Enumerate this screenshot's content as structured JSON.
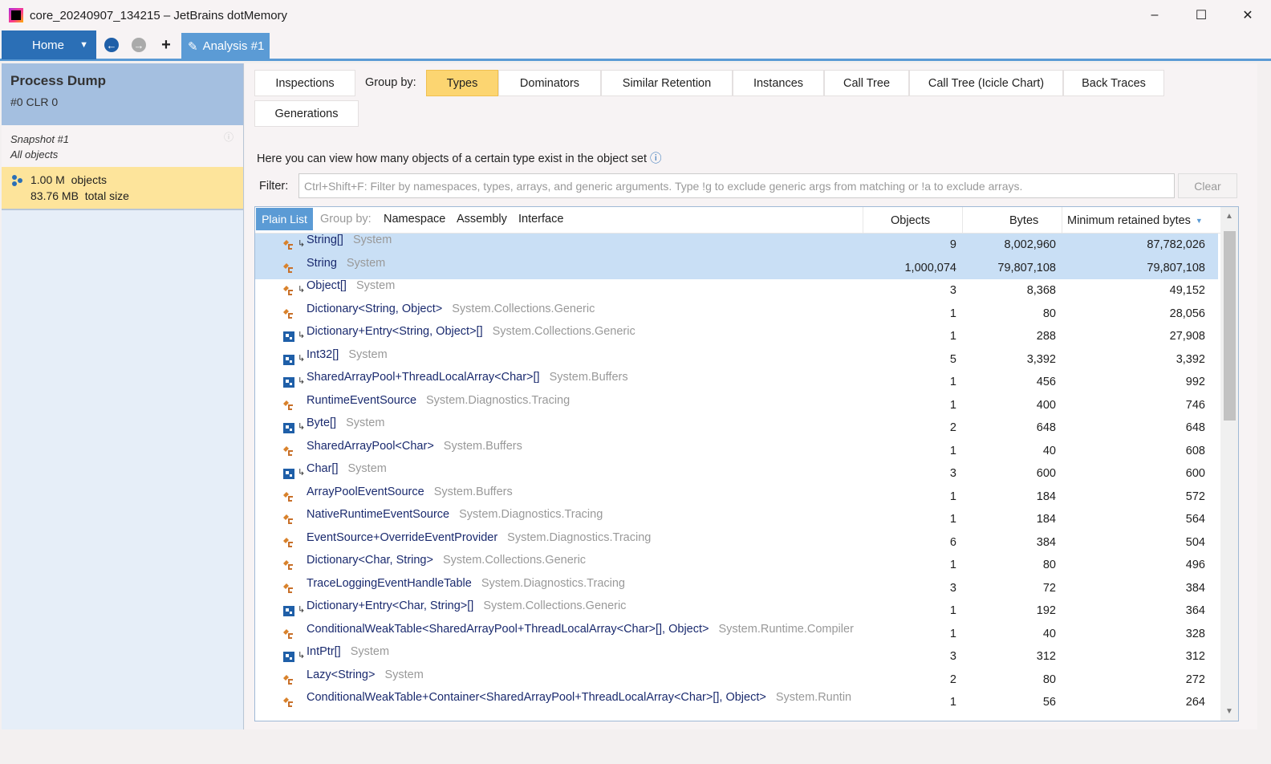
{
  "window": {
    "title": "core_20240907_134215 – JetBrains dotMemory",
    "min": "–",
    "max": "☐",
    "close": "✕"
  },
  "nav": {
    "home": "Home",
    "tab": "Analysis #1"
  },
  "left": {
    "title": "Process Dump",
    "subtitle": "#0 CLR 0",
    "snapshot": "Snapshot #1",
    "scope": "All objects",
    "count": "1.00 M",
    "count_label": "objects",
    "size": "83.76 MB",
    "size_label": "total size"
  },
  "views": {
    "inspections": "Inspections",
    "group_by": "Group by:",
    "types": "Types",
    "dominators": "Dominators",
    "similar": "Similar Retention",
    "instances": "Instances",
    "calltree": "Call Tree",
    "icicle": "Call Tree (Icicle Chart)",
    "backtraces": "Back Traces",
    "generations": "Generations"
  },
  "description": "Here you can view how many objects of a certain type exist in the object set",
  "filter": {
    "label": "Filter:",
    "placeholder": "Ctrl+Shift+F: Filter by namespaces, types, arrays, and generic arguments. Type !g to exclude generic args from matching or !a to exclude arrays.",
    "clear": "Clear"
  },
  "grid": {
    "plain_list": "Plain List",
    "group_by": "Group by:",
    "namespace": "Namespace",
    "assembly": "Assembly",
    "interface": "Interface",
    "col_objects": "Objects",
    "col_bytes": "Bytes",
    "col_retained": "Minimum retained bytes",
    "rows": [
      {
        "icon": "class",
        "array": true,
        "name": "String[]",
        "ns": "System",
        "objects": "9",
        "bytes": "8,002,960",
        "retained": "87,782,026",
        "selected": true
      },
      {
        "icon": "class",
        "array": false,
        "name": "String",
        "ns": "System",
        "objects": "1,000,074",
        "bytes": "79,807,108",
        "retained": "79,807,108",
        "selected": true
      },
      {
        "icon": "class",
        "array": true,
        "name": "Object[]",
        "ns": "System",
        "objects": "3",
        "bytes": "8,368",
        "retained": "49,152"
      },
      {
        "icon": "class",
        "array": false,
        "name": "Dictionary<String, Object>",
        "ns": "System.Collections.Generic",
        "objects": "1",
        "bytes": "80",
        "retained": "28,056"
      },
      {
        "icon": "struct",
        "array": true,
        "name": "Dictionary+Entry<String, Object>[]",
        "ns": "System.Collections.Generic",
        "objects": "1",
        "bytes": "288",
        "retained": "27,908"
      },
      {
        "icon": "struct",
        "array": true,
        "name": "Int32[]",
        "ns": "System",
        "objects": "5",
        "bytes": "3,392",
        "retained": "3,392"
      },
      {
        "icon": "struct",
        "array": true,
        "name": "SharedArrayPool+ThreadLocalArray<Char>[]",
        "ns": "System.Buffers",
        "objects": "1",
        "bytes": "456",
        "retained": "992"
      },
      {
        "icon": "class",
        "array": false,
        "name": "RuntimeEventSource",
        "ns": "System.Diagnostics.Tracing",
        "objects": "1",
        "bytes": "400",
        "retained": "746"
      },
      {
        "icon": "struct",
        "array": true,
        "name": "Byte[]",
        "ns": "System",
        "objects": "2",
        "bytes": "648",
        "retained": "648"
      },
      {
        "icon": "class",
        "array": false,
        "name": "SharedArrayPool<Char>",
        "ns": "System.Buffers",
        "objects": "1",
        "bytes": "40",
        "retained": "608"
      },
      {
        "icon": "struct",
        "array": true,
        "name": "Char[]",
        "ns": "System",
        "objects": "3",
        "bytes": "600",
        "retained": "600"
      },
      {
        "icon": "class",
        "array": false,
        "name": "ArrayPoolEventSource",
        "ns": "System.Buffers",
        "objects": "1",
        "bytes": "184",
        "retained": "572"
      },
      {
        "icon": "class",
        "array": false,
        "name": "NativeRuntimeEventSource",
        "ns": "System.Diagnostics.Tracing",
        "objects": "1",
        "bytes": "184",
        "retained": "564"
      },
      {
        "icon": "class",
        "array": false,
        "name": "EventSource+OverrideEventProvider",
        "ns": "System.Diagnostics.Tracing",
        "objects": "6",
        "bytes": "384",
        "retained": "504"
      },
      {
        "icon": "class",
        "array": false,
        "name": "Dictionary<Char, String>",
        "ns": "System.Collections.Generic",
        "objects": "1",
        "bytes": "80",
        "retained": "496"
      },
      {
        "icon": "class",
        "array": false,
        "name": "TraceLoggingEventHandleTable",
        "ns": "System.Diagnostics.Tracing",
        "objects": "3",
        "bytes": "72",
        "retained": "384"
      },
      {
        "icon": "struct",
        "array": true,
        "name": "Dictionary+Entry<Char, String>[]",
        "ns": "System.Collections.Generic",
        "objects": "1",
        "bytes": "192",
        "retained": "364"
      },
      {
        "icon": "class",
        "array": false,
        "name": "ConditionalWeakTable<SharedArrayPool+ThreadLocalArray<Char>[], Object>",
        "ns": "System.Runtime.Compiler",
        "objects": "1",
        "bytes": "40",
        "retained": "328"
      },
      {
        "icon": "struct",
        "array": true,
        "name": "IntPtr[]",
        "ns": "System",
        "objects": "3",
        "bytes": "312",
        "retained": "312"
      },
      {
        "icon": "class",
        "array": false,
        "name": "Lazy<String>",
        "ns": "System",
        "objects": "2",
        "bytes": "80",
        "retained": "272"
      },
      {
        "icon": "class",
        "array": false,
        "name": "ConditionalWeakTable+Container<SharedArrayPool+ThreadLocalArray<Char>[], Object>",
        "ns": "System.Runtin",
        "objects": "1",
        "bytes": "56",
        "retained": "264"
      }
    ]
  },
  "colors": {
    "accent": "#2b6fb6",
    "active_tab": "#5b9bd5",
    "selected_view": "#fcd571",
    "row_selected": "#c9dff5"
  }
}
